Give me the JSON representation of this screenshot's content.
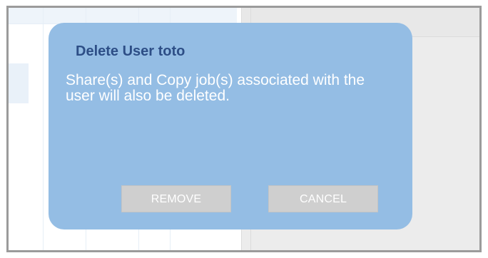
{
  "dialog": {
    "title": "Delete User toto",
    "message": "Share(s) and Copy job(s) associated with the user will also be deleted.",
    "buttons": {
      "remove": "REMOVE",
      "cancel": "CANCEL"
    }
  },
  "colors": {
    "dialog_background": "#94bde4",
    "title_text": "#2d4e86",
    "message_text": "#ffffff",
    "button_background": "#cfcfcf",
    "button_text": "#ffffff"
  }
}
